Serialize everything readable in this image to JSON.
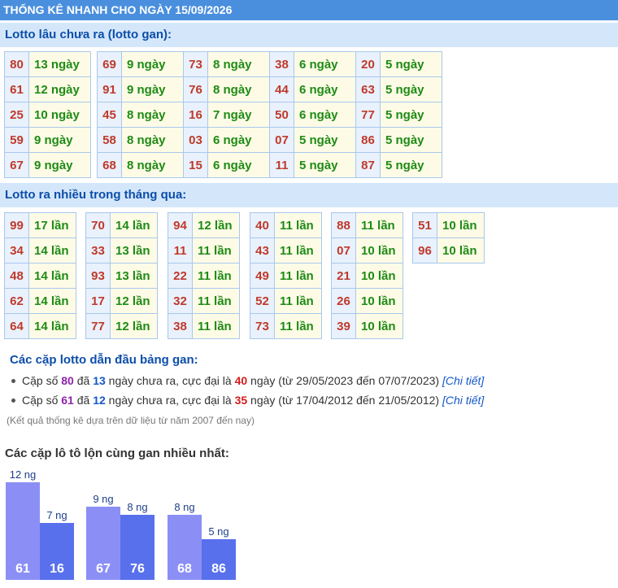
{
  "header": {
    "title": "THỐNG KÊ NHANH CHO NGÀY 15/09/2026"
  },
  "gan_section": {
    "title": "Lotto lâu chưa ra (lotto gan):",
    "groups": [
      [
        [
          "80",
          "13 ngày"
        ],
        [
          "61",
          "12 ngày"
        ],
        [
          "25",
          "10 ngày"
        ],
        [
          "59",
          "9 ngày"
        ],
        [
          "67",
          "9 ngày"
        ]
      ],
      [
        [
          "69",
          "9 ngày"
        ],
        [
          "91",
          "9 ngày"
        ],
        [
          "45",
          "8 ngày"
        ],
        [
          "58",
          "8 ngày"
        ],
        [
          "68",
          "8 ngày"
        ]
      ],
      [
        [
          "73",
          "8 ngày"
        ],
        [
          "76",
          "8 ngày"
        ],
        [
          "16",
          "7 ngày"
        ],
        [
          "03",
          "6 ngày"
        ],
        [
          "15",
          "6 ngày"
        ]
      ],
      [
        [
          "38",
          "6 ngày"
        ],
        [
          "44",
          "6 ngày"
        ],
        [
          "50",
          "6 ngày"
        ],
        [
          "07",
          "5 ngày"
        ],
        [
          "11",
          "5 ngày"
        ]
      ],
      [
        [
          "20",
          "5 ngày"
        ],
        [
          "63",
          "5 ngày"
        ],
        [
          "77",
          "5 ngày"
        ],
        [
          "86",
          "5 ngày"
        ],
        [
          "87",
          "5 ngày"
        ]
      ]
    ]
  },
  "frequent_section": {
    "title": "Lotto ra nhiều trong tháng qua:",
    "groups": [
      [
        [
          "99",
          "17 lần"
        ],
        [
          "34",
          "14 lần"
        ],
        [
          "48",
          "14 lần"
        ],
        [
          "62",
          "14 lần"
        ],
        [
          "64",
          "14 lần"
        ]
      ],
      [
        [
          "70",
          "14 lần"
        ],
        [
          "33",
          "13 lần"
        ],
        [
          "93",
          "13 lần"
        ],
        [
          "17",
          "12 lần"
        ],
        [
          "77",
          "12 lần"
        ]
      ],
      [
        [
          "94",
          "12 lần"
        ],
        [
          "11",
          "11 lần"
        ],
        [
          "22",
          "11 lần"
        ],
        [
          "32",
          "11 lần"
        ],
        [
          "38",
          "11 lần"
        ]
      ],
      [
        [
          "40",
          "11 lần"
        ],
        [
          "43",
          "11 lần"
        ],
        [
          "49",
          "11 lần"
        ],
        [
          "52",
          "11 lần"
        ],
        [
          "73",
          "11 lần"
        ]
      ],
      [
        [
          "88",
          "11 lần"
        ],
        [
          "07",
          "10 lần"
        ],
        [
          "21",
          "10 lần"
        ],
        [
          "26",
          "10 lần"
        ],
        [
          "39",
          "10 lần"
        ]
      ],
      [
        [
          "51",
          "10 lần"
        ],
        [
          "96",
          "10 lần"
        ]
      ]
    ]
  },
  "pairs_section": {
    "title": "Các cặp lotto dẫn đầu bảng gan:",
    "rows": [
      {
        "t1": "Cặp số ",
        "num": "80",
        "t2": " đã ",
        "days": "13",
        "t3": " ngày chưa ra, cực đại là ",
        "max": "40",
        "t4": " ngày (từ 29/05/2023 đến 07/07/2023) ",
        "link": "[Chi tiết]"
      },
      {
        "t1": "Cặp số ",
        "num": "61",
        "t2": " đã ",
        "days": "12",
        "t3": " ngày chưa ra, cực đại là ",
        "max": "35",
        "t4": " ngày (từ 17/04/2012 đến 21/05/2012) ",
        "link": "[Chi tiết]"
      }
    ],
    "note": "(Kết quả thống kê dựa trên dữ liệu từ năm 2007 đến nay)"
  },
  "chart_title": "Các cặp lô tô lộn cùng gan nhiều nhất:",
  "colors": {
    "bar_light": "#8b8ff5",
    "bar_dark": "#5870ec",
    "header": "#4a8fde",
    "section": "#d4e7fa"
  },
  "chart_data": {
    "type": "bar",
    "title": "Các cặp lô tô lộn cùng gan nhiều nhất:",
    "categories": [
      "61",
      "16",
      "67",
      "76",
      "68",
      "86"
    ],
    "values": [
      12,
      7,
      9,
      8,
      8,
      5
    ],
    "labels": [
      "12 ng",
      "7 ng",
      "9 ng",
      "8 ng",
      "8 ng",
      "5 ng"
    ]
  }
}
